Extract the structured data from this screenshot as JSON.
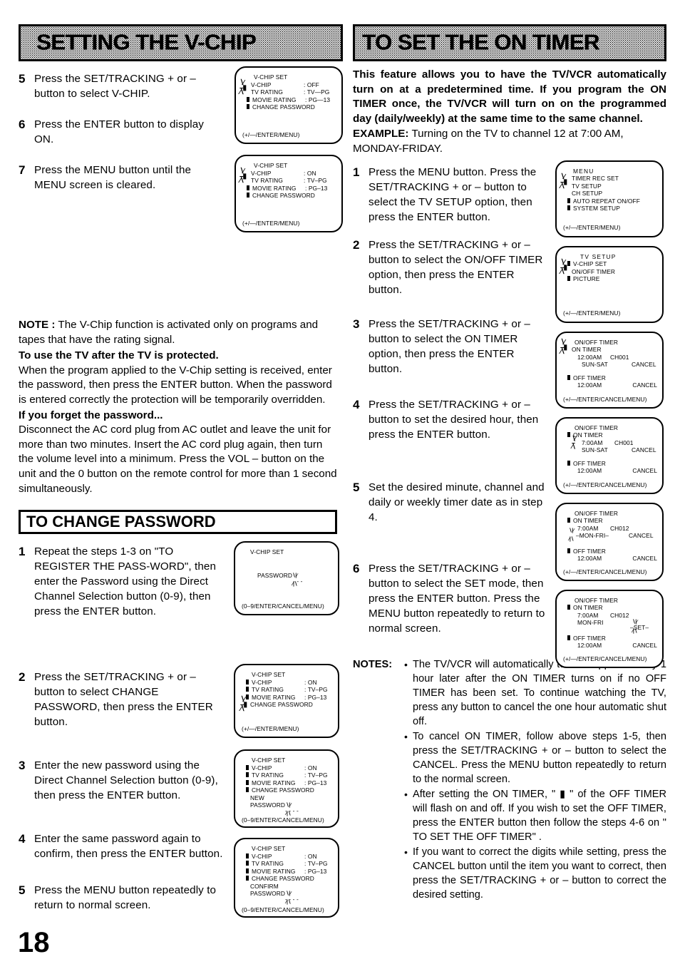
{
  "page": {
    "number": "18"
  },
  "left": {
    "banner_title": "SETTING THE V-CHIP",
    "steps": [
      {
        "num": "5",
        "text": "Press the SET/TRACKING + or – button to select  V-CHIP."
      },
      {
        "num": "6",
        "text": "Press the ENTER button to display ON."
      },
      {
        "num": "7",
        "text": "Press the MENU button until the MENU screen is cleared."
      }
    ],
    "osd_vchip_off": {
      "title": "V-CHIP SET",
      "rows": [
        {
          "label": "V-CHIP",
          "value": ": OFF"
        },
        {
          "label": "TV RATING",
          "value": ": TV—PG"
        },
        {
          "label": "MOVIE RATING",
          "value": ": PG—13"
        },
        {
          "label": "CHANGE PASSWORD",
          "value": ""
        }
      ],
      "footer": "(+/—/ENTER/MENU)"
    },
    "osd_vchip_on": {
      "title": "V-CHIP SET",
      "rows": [
        {
          "label": "V-CHIP",
          "value": ": ON"
        },
        {
          "label": "TV RATING",
          "value": ": TV–PG"
        },
        {
          "label": "MOVIE RATING",
          "value": ": PG–13"
        },
        {
          "label": "CHANGE PASSWORD",
          "value": ""
        }
      ],
      "footer": "(+/—/ENTER/MENU)"
    },
    "note_label": "NOTE :",
    "note_text": "The V-Chip function is activated only on programs and tapes that have the rating signal.",
    "protected_heading": "To use the TV after the TV is protected.",
    "protected_text": "When the program applied to the V-Chip setting is received, enter the password, then press the ENTER button. When the password is entered correctly the protection will be temporarily overridden.",
    "forgot_heading": "If you forget the password...",
    "forgot_text": "Disconnect the AC cord plug from AC outlet and leave the unit for more than two minutes. Insert the AC cord plug again, then turn the volume level into a minimum. Press the VOL – button on the unit and the 0 button on the remote control for more than 1 second simultaneously.",
    "subhead_password": "TO CHANGE PASSWORD",
    "pw_steps": [
      {
        "num": "1",
        "text": "Repeat the steps 1-3 on \"TO REGISTER THE PASS-WORD\", then enter the Password using the Direct Channel Selection button (0-9), then press the ENTER button."
      },
      {
        "num": "2",
        "text": "Press the SET/TRACKING + or – button to select CHANGE PASSWORD, then press the ENTER button."
      },
      {
        "num": "3",
        "text": "Enter the new password using the Direct Channel Selection button (0-9), then press the ENTER button."
      },
      {
        "num": "4",
        "text": "Enter the same password again to confirm, then press the ENTER button."
      },
      {
        "num": "5",
        "text": "Press the MENU button repeatedly to return to normal screen."
      }
    ],
    "osd_password_entry": {
      "title": "V-CHIP SET",
      "prompt": "PASSWORD",
      "dashes": "- - -",
      "footer": "(0–9/ENTER/CANCEL/MENU)"
    },
    "osd_change_pw": {
      "title": "V-CHIP SET",
      "rows": [
        {
          "label": "V-CHIP",
          "value": ": ON"
        },
        {
          "label": "TV RATING",
          "value": ": TV–PG"
        },
        {
          "label": "MOVIE RATING",
          "value": ": PG–13"
        },
        {
          "label": "CHANGE PASSWORD",
          "value": ""
        }
      ],
      "footer": "(+/—/ENTER/MENU)"
    },
    "osd_new_pw": {
      "title": "V-CHIP SET",
      "rows": [
        {
          "label": "V-CHIP",
          "value": ": ON"
        },
        {
          "label": "TV RATING",
          "value": ": TV–PG"
        },
        {
          "label": "MOVIE RATING",
          "value": ": PG–13"
        },
        {
          "label": "CHANGE PASSWORD",
          "value": ""
        }
      ],
      "prompt_line1": "NEW",
      "prompt_line2": "PASSWORD",
      "dashes": "- - - -",
      "footer": "(0–9/ENTER/CANCEL/MENU)"
    },
    "osd_confirm_pw": {
      "title": "V-CHIP SET",
      "rows": [
        {
          "label": "V-CHIP",
          "value": ": ON"
        },
        {
          "label": "TV RATING",
          "value": ": TV–PG"
        },
        {
          "label": "MOVIE RATING",
          "value": ": PG–13"
        },
        {
          "label": "CHANGE PASSWORD",
          "value": ""
        }
      ],
      "prompt_line1": "CONFIRM",
      "prompt_line2": "PASSWORD",
      "dashes": "- - - -",
      "footer": "(0–9/ENTER/CANCEL/MENU)"
    }
  },
  "right": {
    "banner_title": "TO SET THE ON TIMER",
    "intro_bold": "This feature allows you to have the TV/VCR automatically turn on at a predetermined time. If you program the ON TIMER once, the TV/VCR will turn on on the programmed day (daily/weekly) at the same time to the same channel.",
    "example_label": "EXAMPLE:",
    "example_text": "Turning on the TV to channel 12 at 7:00 AM, MONDAY-FRIDAY.",
    "steps": [
      {
        "num": "1",
        "text": "Press the MENU button. Press the SET/TRACKING + or – button to select the TV SETUP option, then press the ENTER button."
      },
      {
        "num": "2",
        "text": "Press the SET/TRACKING + or – button to select the ON/OFF TIMER option, then press the ENTER button."
      },
      {
        "num": "3",
        "text": "Press the SET/TRACKING + or – button to select the ON TIMER option, then press the ENTER button."
      },
      {
        "num": "4",
        "text": "Press the SET/TRACKING + or – button to set the desired hour, then press the ENTER button."
      },
      {
        "num": "5",
        "text": "Set the desired minute, channel and daily or weekly timer date as in step 4."
      },
      {
        "num": "6",
        "text": "Press the SET/TRACKING + or – button to select the SET mode, then press the ENTER button. Press the MENU button repeatedly to return to normal screen."
      }
    ],
    "osd_menu": {
      "title": "MENU",
      "items": [
        "TIMER REC SET",
        "TV SETUP",
        "CH SETUP",
        "AUTO REPEAT  ON/OFF",
        "SYSTEM SETUP"
      ],
      "footer": "(+/—/ENTER/MENU)"
    },
    "osd_tv_setup": {
      "title": "TV SETUP",
      "items": [
        "V-CHIP SET",
        "ON/OFF TIMER",
        "PICTURE"
      ],
      "footer": "(+/—/ENTER/MENU)"
    },
    "osd_timer_3": {
      "title": "ON/OFF TIMER",
      "on_label": "ON TIMER",
      "on_time": "12:00AM",
      "on_channel": "CH001",
      "on_days": "SUN-SAT",
      "on_cancel": "CANCEL",
      "off_label": "OFF TIMER",
      "off_time": "12:00AM",
      "off_cancel": "CANCEL",
      "footer": "(+/—/ENTER/CANCEL/MENU)"
    },
    "osd_timer_4": {
      "title": "ON/OFF TIMER",
      "on_label": "ON TIMER",
      "on_time": "7:00AM",
      "on_channel": "CH001",
      "on_days": "SUN-SAT",
      "on_cancel": "CANCEL",
      "off_label": "OFF TIMER",
      "off_time": "12:00AM",
      "off_cancel": "CANCEL",
      "footer": "(+/—/ENTER/CANCEL/MENU)"
    },
    "osd_timer_5": {
      "title": "ON/OFF TIMER",
      "on_label": "ON TIMER",
      "on_time": "7:00AM",
      "on_channel": "CH012",
      "on_days": "MON-FRI",
      "on_cancel": "CANCEL",
      "off_label": "OFF TIMER",
      "off_time": "12:00AM",
      "off_cancel": "CANCEL",
      "footer": "(+/—/ENTER/CANCEL/MENU)"
    },
    "osd_timer_6": {
      "title": "ON/OFF TIMER",
      "on_label": "ON TIMER",
      "on_time": "7:00AM",
      "on_channel": "CH012",
      "on_days": "MON-FRI",
      "on_set": "SET",
      "off_label": "OFF TIMER",
      "off_time": "12:00AM",
      "off_cancel": "CANCEL",
      "footer": "(+/—/ENTER/CANCEL/MENU)"
    },
    "notes_label": "NOTES:",
    "notes": [
      "The TV/VCR will automatically turn off approximately 1 hour later after the ON TIMER turns on if no OFF TIMER has been set. To continue watching the TV, press any button to cancel the one hour automatic shut off.",
      "To cancel ON TIMER, follow above steps 1-5, then press the SET/TRACKING + or – button to select the CANCEL. Press the MENU button repeatedly to return to the normal screen.",
      "After setting the ON TIMER, \" ▮ \" of the OFF TIMER will flash on and off. If you wish to set the OFF TIMER, press the ENTER button then follow the steps 4-6 on \" TO SET THE OFF TIMER\" .",
      "If you want to correct the digits while setting, press the CANCEL button until the item you want to correct, then press the SET/TRACKING + or – button to correct the desired setting."
    ]
  }
}
